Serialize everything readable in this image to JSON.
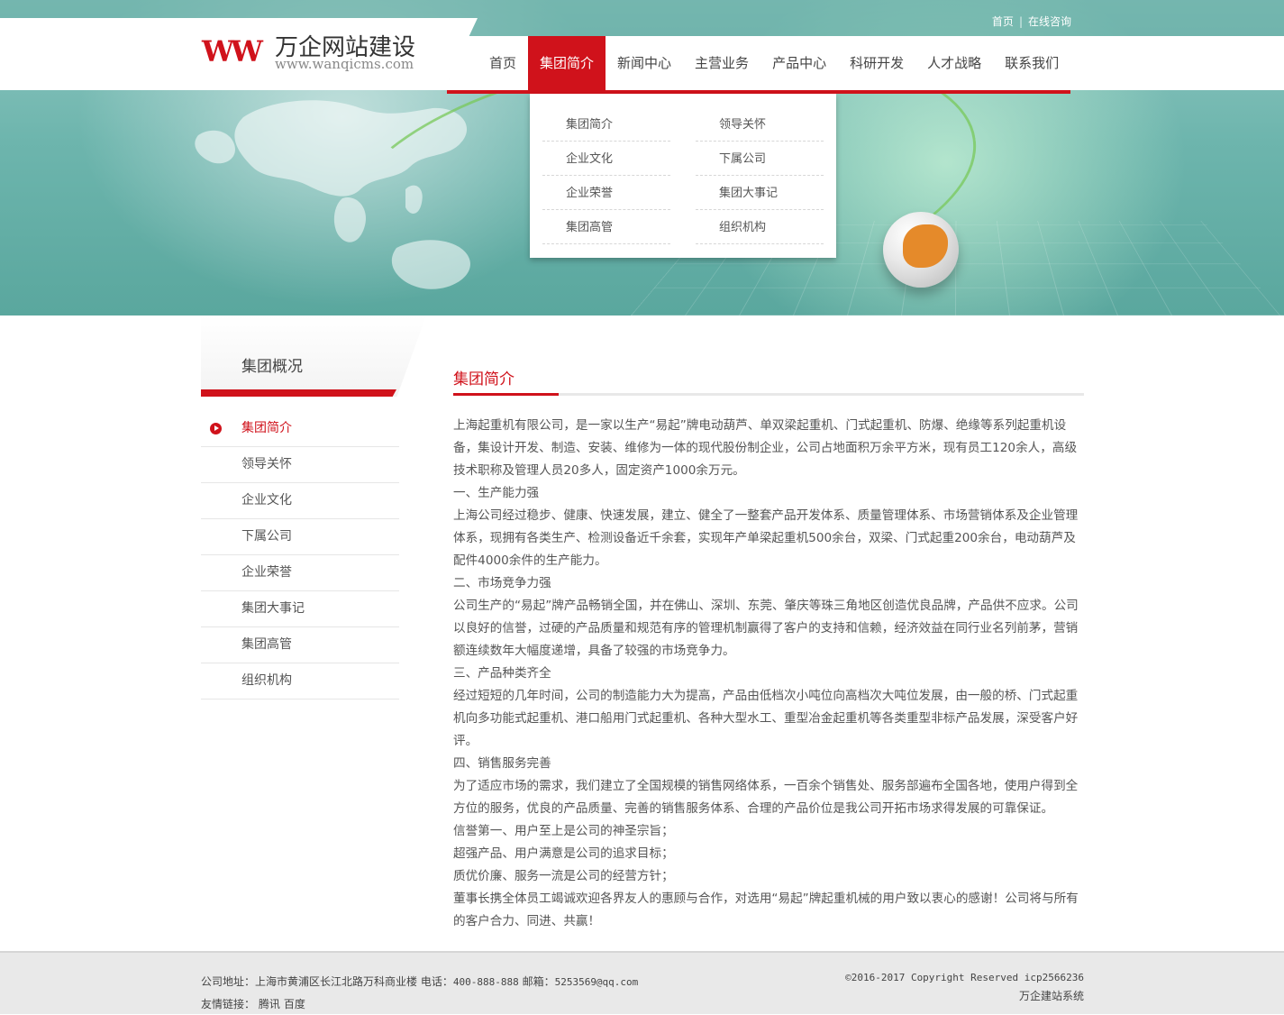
{
  "header": {
    "top_links": [
      "首页",
      "在线咨询"
    ],
    "top_sep": "|",
    "logo_mark": "WW",
    "logo_title": "万企网站建设",
    "logo_url": "www.wanqicms.com"
  },
  "nav": {
    "items": [
      "首页",
      "集团简介",
      "新闻中心",
      "主营业务",
      "产品中心",
      "科研开发",
      "人才战略",
      "联系我们"
    ],
    "active_index": 1
  },
  "dropdown": {
    "left": [
      "集团简介",
      "企业文化",
      "企业荣誉",
      "集团高管"
    ],
    "right": [
      "领导关怀",
      "下属公司",
      "集团大事记",
      "组织机构"
    ]
  },
  "sidebar": {
    "title": "集团概况",
    "items": [
      "集团简介",
      "领导关怀",
      "企业文化",
      "下属公司",
      "企业荣誉",
      "集团大事记",
      "集团高管",
      "组织机构"
    ],
    "active_index": 0
  },
  "main": {
    "title": "集团简介",
    "paragraphs": [
      "上海起重机有限公司，是一家以生产“易起”牌电动葫芦、单双梁起重机、门式起重机、防爆、绝缘等系列起重机设备，集设计开发、制造、安装、维修为一体的现代股份制企业，公司占地面积万余平方米，现有员工120余人，高级技术职称及管理人员20多人，固定资产1000余万元。",
      "一、生产能力强",
      "上海公司经过稳步、健康、快速发展，建立、健全了一整套产品开发体系、质量管理体系、市场营销体系及企业管理体系，现拥有各类生产、检测设备近千余套，实现年产单梁起重机500余台，双梁、门式起重200余台，电动葫芦及配件4000余件的生产能力。",
      "二、市场竞争力强",
      "公司生产的“易起”牌产品畅销全国，并在佛山、深圳、东莞、肇庆等珠三角地区创造优良品牌，产品供不应求。公司以良好的信誉，过硬的产品质量和规范有序的管理机制赢得了客户的支持和信赖，经济效益在同行业名列前茅，营销额连续数年大幅度递增，具备了较强的市场竞争力。",
      "三、产品种类齐全",
      "经过短短的几年时间，公司的制造能力大为提高，产品由低档次小吨位向高档次大吨位发展，由一般的桥、门式起重机向多功能式起重机、港口船用门式起重机、各种大型水工、重型冶金起重机等各类重型非标产品发展，深受客户好评。",
      "四、销售服务完善",
      "为了适应市场的需求，我们建立了全国规模的销售网络体系，一百余个销售处、服务部遍布全国各地，使用户得到全方位的服务，优良的产品质量、完善的销售服务体系、合理的产品价位是我公司开拓市场求得发展的可靠保证。",
      "信誉第一、用户至上是公司的神圣宗旨；",
      "超强产品、用户满意是公司的追求目标；",
      "质优价廉、服务一流是公司的经营方针；",
      "董事长携全体员工竭诚欢迎各界友人的惠顾与合作，对选用“易起”牌起重机械的用户致以衷心的感谢！公司将与所有的客户合力、同进、共赢！"
    ]
  },
  "footer": {
    "address_label": "公司地址：",
    "address": "上海市黄浦区长江北路万科商业楼",
    "phone_label": "电话：",
    "phone": "400-888-888",
    "email_label": "邮箱：",
    "email": "5253569@qq.com",
    "links_label": "友情链接：",
    "links": [
      "腾讯",
      "百度"
    ],
    "copyright": "©2016-2017 Copyright Reserved icp2566236",
    "system": "万企建站系统"
  }
}
